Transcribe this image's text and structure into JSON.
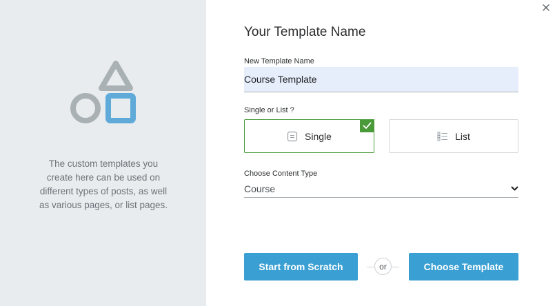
{
  "left_panel": {
    "description": "The custom templates you create here can be used on different types of posts, as well as various pages, or list pages."
  },
  "heading": "Your Template Name",
  "name_field": {
    "label": "New Template Name",
    "value": "Course Template"
  },
  "type_field": {
    "label": "Single or List ?",
    "options": [
      {
        "label": "Single",
        "icon": "single-page-icon",
        "selected": true
      },
      {
        "label": "List",
        "icon": "list-icon",
        "selected": false
      }
    ]
  },
  "content_type": {
    "label": "Choose Content Type",
    "value": "Course"
  },
  "actions": {
    "scratch_label": "Start from Scratch",
    "or_label": "or",
    "template_label": "Choose Template"
  },
  "colors": {
    "accent": "#3a9fd3",
    "selected_border": "#4a9a3a",
    "shape_gray": "#a9b1b4",
    "shape_blue": "#5faad9"
  }
}
